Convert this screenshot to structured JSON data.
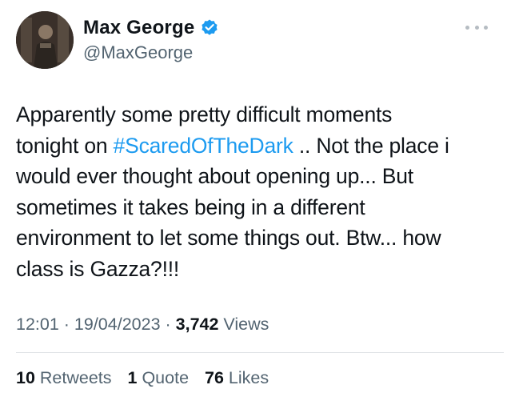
{
  "author": {
    "display_name": "Max George",
    "handle": "@MaxGeorge",
    "verified": true,
    "avatar_icon": "profile-photo",
    "verified_icon": "verified-badge-icon",
    "more_icon": "more-options-icon"
  },
  "tweet": {
    "lines": [
      {
        "text": "Apparently some pretty difficult moments"
      },
      {
        "pre": "tonight on ",
        "hashtag": "#ScaredOfTheDark",
        "post": " .. Not the place i"
      },
      {
        "text": "would ever thought about opening up... But"
      },
      {
        "text": "sometimes it takes being in a different"
      },
      {
        "text": "environment to let some things out. Btw... how"
      },
      {
        "text": "class is Gazza?!!!"
      }
    ]
  },
  "meta": {
    "time": "12:01",
    "sep1": " · ",
    "date": "19/04/2023",
    "sep2": " · ",
    "views_count": "3,742",
    "views_label": " Views"
  },
  "stats": {
    "retweets_count": "10",
    "retweets_label": " Retweets",
    "quotes_count": "1",
    "quotes_label": " Quote",
    "likes_count": "76",
    "likes_label": " Likes"
  },
  "colors": {
    "hashtag": "#1d9bf0",
    "verified_badge": "#1d9bf0",
    "secondary_text": "#536471",
    "primary_text": "#0f1419"
  }
}
